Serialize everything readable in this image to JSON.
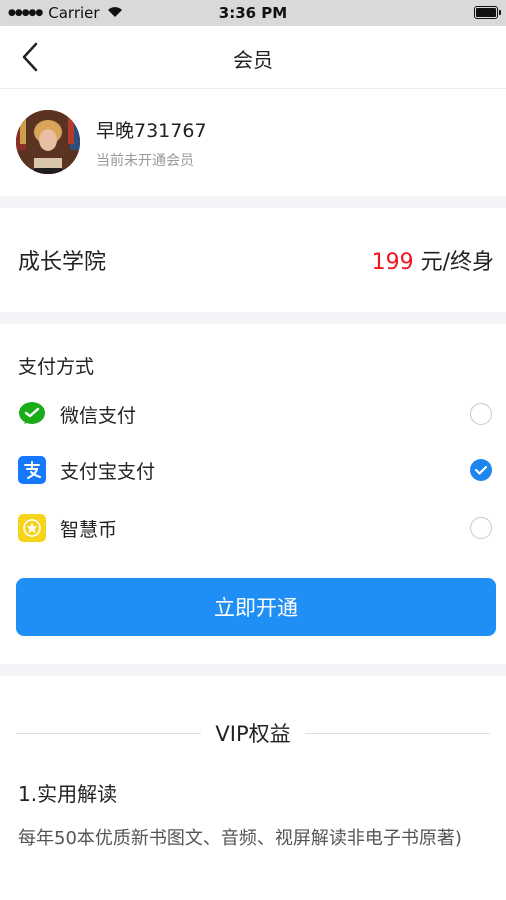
{
  "status_bar": {
    "carrier": "Carrier",
    "time": "3:36 PM"
  },
  "nav": {
    "title": "会员"
  },
  "profile": {
    "name": "早晚731767",
    "status": "当前未开通会员"
  },
  "course": {
    "name": "成长学院",
    "price": "199",
    "price_suffix": "元/终身"
  },
  "payment": {
    "title": "支付方式",
    "options": [
      {
        "label": "微信支付",
        "icon": "wechat-pay-icon",
        "selected": false
      },
      {
        "label": "支付宝支付",
        "icon": "alipay-icon",
        "selected": true
      },
      {
        "label": "智慧币",
        "icon": "coin-icon",
        "selected": false
      }
    ]
  },
  "open_button": {
    "label": "立即开通"
  },
  "vip": {
    "heading": "VIP权益",
    "benefit_title": "1.实用解读",
    "benefit_desc": "每年50本优质新书图文、音频、视屏解读非电子书原著)"
  },
  "colors": {
    "accent": "#1f8ff5",
    "price": "#f0141e",
    "wechat": "#1aad19",
    "alipay": "#1677ff",
    "coin": "#f5d318"
  }
}
